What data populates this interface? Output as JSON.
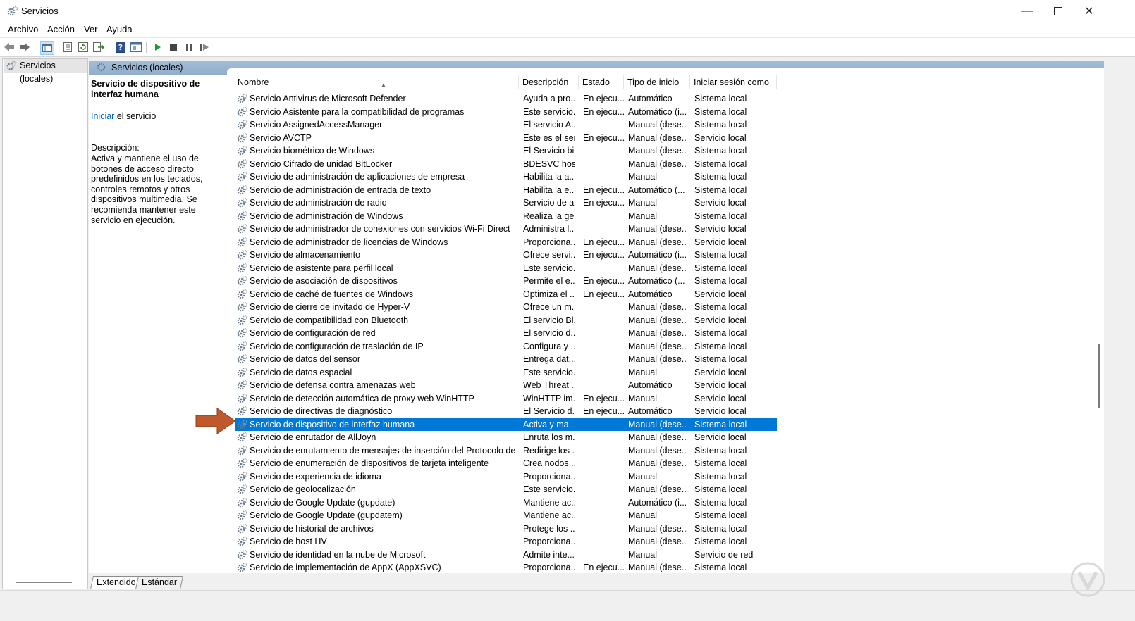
{
  "window": {
    "title": "Servicios",
    "minimize_icon": "minimize-icon",
    "maximize_icon": "maximize-icon",
    "close_icon": "close-icon"
  },
  "menu": [
    "Archivo",
    "Acción",
    "Ver",
    "Ayuda"
  ],
  "toolbar": [
    "back-icon",
    "forward-icon",
    "console-tree-icon",
    "properties-icon",
    "refresh-icon",
    "export-icon",
    "help-icon",
    "view-icon",
    "start-icon",
    "stop-icon",
    "pause-icon",
    "restart-icon"
  ],
  "tree": {
    "root": "Servicios (locales)"
  },
  "panel_header": "Servicios (locales)",
  "detail": {
    "service_title": "Servicio de dispositivo de interfaz humana",
    "start_link": "Iniciar",
    "start_suffix": " el servicio",
    "description_label": "Descripción:",
    "description": "Activa y mantiene el uso de botones de acceso directo predefinidos en los teclados, controles remotos y otros dispositivos multimedia. Se recomienda mantener este servicio en ejecución."
  },
  "columns": [
    "Nombre",
    "Descripción",
    "Estado",
    "Tipo de inicio",
    "Iniciar sesión como"
  ],
  "selected_row": 25,
  "rows": [
    [
      "Servicio Antivirus de Microsoft Defender",
      "Ayuda a pro...",
      "En ejecu...",
      "Automático",
      "Sistema local"
    ],
    [
      "Servicio Asistente para la compatibilidad de programas",
      "Este servicio...",
      "En ejecu...",
      "Automático (i...",
      "Sistema local"
    ],
    [
      "Servicio AssignedAccessManager",
      "El servicio A...",
      "",
      "Manual (dese...",
      "Sistema local"
    ],
    [
      "Servicio AVCTP",
      "Este es el ser...",
      "En ejecu...",
      "Manual (dese...",
      "Servicio local"
    ],
    [
      "Servicio biométrico de Windows",
      "El Servicio bi...",
      "",
      "Manual (dese...",
      "Sistema local"
    ],
    [
      "Servicio Cifrado de unidad BitLocker",
      "BDESVC hosp...",
      "",
      "Manual (dese...",
      "Sistema local"
    ],
    [
      "Servicio de administración de aplicaciones de empresa",
      "Habilita la a...",
      "",
      "Manual",
      "Sistema local"
    ],
    [
      "Servicio de administración de entrada de texto",
      "Habilita la e...",
      "En ejecu...",
      "Automático (...",
      "Sistema local"
    ],
    [
      "Servicio de administración de radio",
      "Servicio de a...",
      "En ejecu...",
      "Manual",
      "Servicio local"
    ],
    [
      "Servicio de administración de Windows",
      "Realiza la ge...",
      "",
      "Manual",
      "Sistema local"
    ],
    [
      "Servicio de administrador de conexiones con servicios Wi-Fi Direct",
      "Administra l...",
      "",
      "Manual (dese...",
      "Servicio local"
    ],
    [
      "Servicio de administrador de licencias de Windows",
      "Proporciona...",
      "En ejecu...",
      "Manual (dese...",
      "Servicio local"
    ],
    [
      "Servicio de almacenamiento",
      "Ofrece servi...",
      "En ejecu...",
      "Automático (i...",
      "Sistema local"
    ],
    [
      "Servicio de asistente para perfil local",
      "Este servicio...",
      "",
      "Manual (dese...",
      "Sistema local"
    ],
    [
      "Servicio de asociación de dispositivos",
      "Permite el e...",
      "En ejecu...",
      "Automático (...",
      "Sistema local"
    ],
    [
      "Servicio de caché de fuentes de Windows",
      "Optimiza el ...",
      "En ejecu...",
      "Automático",
      "Servicio local"
    ],
    [
      "Servicio de cierre de invitado de Hyper-V",
      "Ofrece un m...",
      "",
      "Manual (dese...",
      "Sistema local"
    ],
    [
      "Servicio de compatibilidad con Bluetooth",
      "El servicio Bl...",
      "",
      "Manual (dese...",
      "Servicio local"
    ],
    [
      "Servicio de configuración de red",
      "El servicio d...",
      "",
      "Manual (dese...",
      "Sistema local"
    ],
    [
      "Servicio de configuración de traslación de IP",
      "Configura y ...",
      "",
      "Manual (dese...",
      "Sistema local"
    ],
    [
      "Servicio de datos del sensor",
      "Entrega dat...",
      "",
      "Manual (dese...",
      "Sistema local"
    ],
    [
      "Servicio de datos espacial",
      "Este servicio...",
      "",
      "Manual",
      "Servicio local"
    ],
    [
      "Servicio de defensa contra amenazas web",
      "Web Threat ...",
      "",
      "Automático",
      "Servicio local"
    ],
    [
      "Servicio de detección automática de proxy web WinHTTP",
      "WinHTTP im...",
      "En ejecu...",
      "Manual",
      "Servicio local"
    ],
    [
      "Servicio de directivas de diagnóstico",
      "El Servicio d...",
      "En ejecu...",
      "Automático",
      "Servicio local"
    ],
    [
      "Servicio de dispositivo de interfaz humana",
      "Activa y ma...",
      "",
      "Manual (dese...",
      "Sistema local"
    ],
    [
      "Servicio de enrutador de AllJoyn",
      "Enruta los m...",
      "",
      "Manual (dese...",
      "Servicio local"
    ],
    [
      "Servicio de enrutamiento de mensajes de inserción del Protocolo de apli...",
      "Redirige los ...",
      "",
      "Manual (dese...",
      "Sistema local"
    ],
    [
      "Servicio de enumeración de dispositivos de tarjeta inteligente",
      "Crea nodos ...",
      "",
      "Manual (dese...",
      "Sistema local"
    ],
    [
      "Servicio de experiencia de idioma",
      "Proporciona...",
      "",
      "Manual",
      "Sistema local"
    ],
    [
      "Servicio de geolocalización",
      "Este servicio...",
      "",
      "Manual (dese...",
      "Sistema local"
    ],
    [
      "Servicio de Google Update (gupdate)",
      "Mantiene ac...",
      "",
      "Automático (i...",
      "Sistema local"
    ],
    [
      "Servicio de Google Update (gupdatem)",
      "Mantiene ac...",
      "",
      "Manual",
      "Sistema local"
    ],
    [
      "Servicio de historial de archivos",
      "Protege los ...",
      "",
      "Manual (dese...",
      "Sistema local"
    ],
    [
      "Servicio de host HV",
      "Proporciona...",
      "",
      "Manual (dese...",
      "Sistema local"
    ],
    [
      "Servicio de identidad en la nube de Microsoft",
      "Admite inte...",
      "",
      "Manual",
      "Servicio de red"
    ],
    [
      "Servicio de implementación de AppX (AppXSVC)",
      "Proporciona...",
      "En ejecu...",
      "Manual (dese...",
      "Sistema local"
    ]
  ],
  "tabs": [
    "Extendido",
    "Estándar"
  ],
  "colors": {
    "selection": "#0078d7",
    "header": "#9fb9d3",
    "arrow": "#c0582d"
  }
}
